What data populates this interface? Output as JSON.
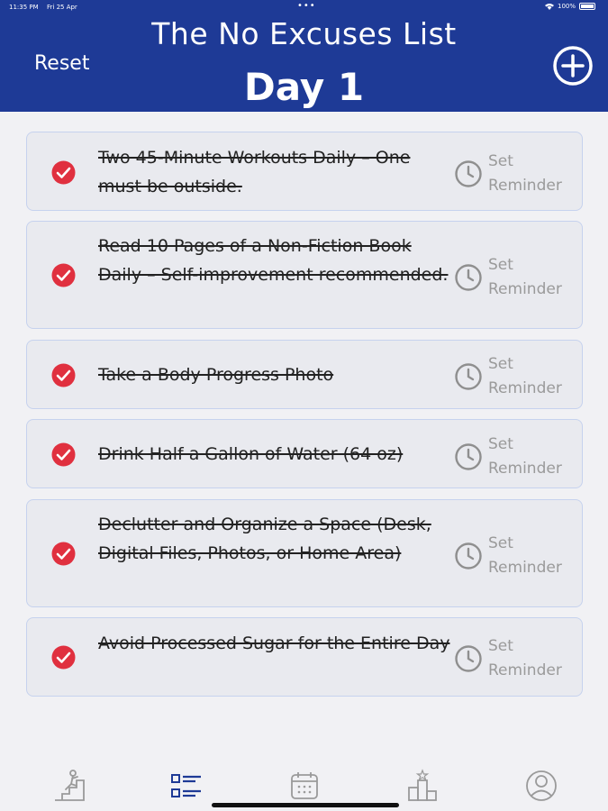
{
  "status_bar": {
    "time": "11:35 PM",
    "date": "Fri 25 Apr",
    "dots": "•••",
    "battery": "100%"
  },
  "header": {
    "title": "The No Excuses List",
    "day": "Day 1",
    "reset_label": "Reset",
    "add_icon": "plus-circle-icon"
  },
  "tasks": [
    {
      "text": "Two 45-Minute Workouts Daily – One must be outside.",
      "completed": true,
      "reminder_label": "Set Reminder"
    },
    {
      "text": "Read 10 Pages of a Non-Fiction Book Daily – Self-improvement recommended.",
      "completed": true,
      "reminder_label": "Set Reminder"
    },
    {
      "text": "Take a Body Progress Photo",
      "completed": true,
      "reminder_label": "Set Reminder"
    },
    {
      "text": "Drink Half a Gallon of Water (64 oz)",
      "completed": true,
      "reminder_label": "Set Reminder"
    },
    {
      "text": "Declutter and Organize a Space (Desk, Digital Files, Photos, or Home Area)",
      "completed": true,
      "reminder_label": "Set Reminder"
    },
    {
      "text": "Avoid Processed Sugar for the Entire Day",
      "completed": true,
      "reminder_label": "Set Reminder"
    }
  ],
  "tabbar": {
    "tabs": [
      {
        "icon": "progress-stairs-icon",
        "active": false
      },
      {
        "icon": "checklist-icon",
        "active": true
      },
      {
        "icon": "calendar-icon",
        "active": false
      },
      {
        "icon": "leaderboard-icon",
        "active": false
      },
      {
        "icon": "profile-icon",
        "active": false
      }
    ]
  },
  "colors": {
    "header_bg": "#1e3a96",
    "check_red": "#e0303f",
    "active_tab": "#1e3a96",
    "inactive_tab": "#9a9a9a"
  }
}
